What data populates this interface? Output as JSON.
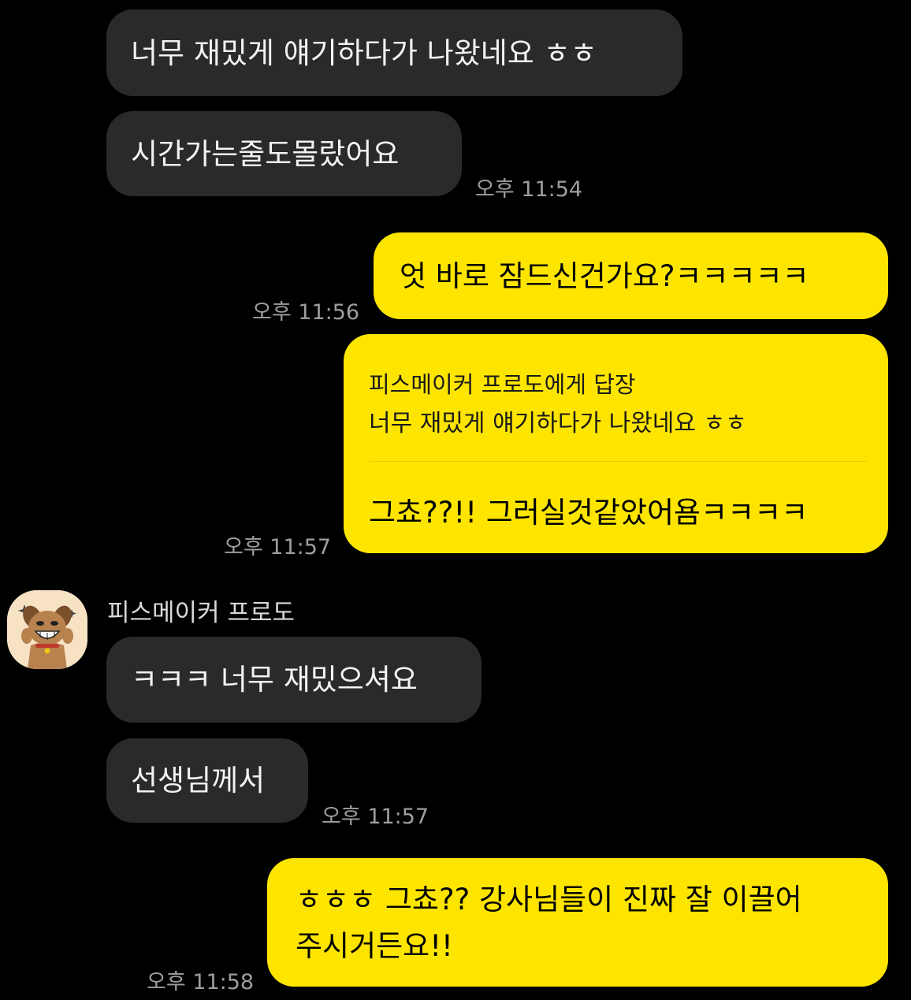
{
  "conversation": {
    "sender_name": "피스메이커 프로도",
    "messages": [
      {
        "id": "m1",
        "side": "in",
        "text": "너무 재밌게 얘기하다가 나왔네요 ㅎㅎ"
      },
      {
        "id": "m2",
        "side": "in",
        "text": "시간가는줄도몰랐어요",
        "time": "오후 11:54"
      },
      {
        "id": "m3",
        "side": "out",
        "text": "엇 바로 잠드신건가요?ㅋㅋㅋㅋㅋ",
        "time": "오후 11:56"
      },
      {
        "id": "m4",
        "side": "out",
        "reply_to_header": "피스메이커 프로도에게 답장",
        "reply_to_text": "너무 재밌게 얘기하다가 나왔네요 ㅎㅎ",
        "text": "그쵸??!! 그러실것같았어욤ㅋㅋㅋㅋ",
        "time": "오후 11:57"
      },
      {
        "id": "m5",
        "side": "in",
        "text": "ㅋㅋㅋ 너무 재밌으셔요"
      },
      {
        "id": "m6",
        "side": "in",
        "text": "선생님께서",
        "time": "오후 11:57"
      },
      {
        "id": "m7",
        "side": "out",
        "line1": "ㅎㅎㅎ 그쵸?? 강사님들이 진짜 잘 이끌어",
        "line2": "주시거든요!!",
        "time": "오후 11:58"
      }
    ]
  },
  "colors": {
    "background": "#000000",
    "incoming_bubble": "#2a2a2a",
    "outgoing_bubble": "#fee500",
    "timestamp": "#9e9e9e"
  },
  "icons": {
    "avatar": "dog-character-avatar"
  }
}
